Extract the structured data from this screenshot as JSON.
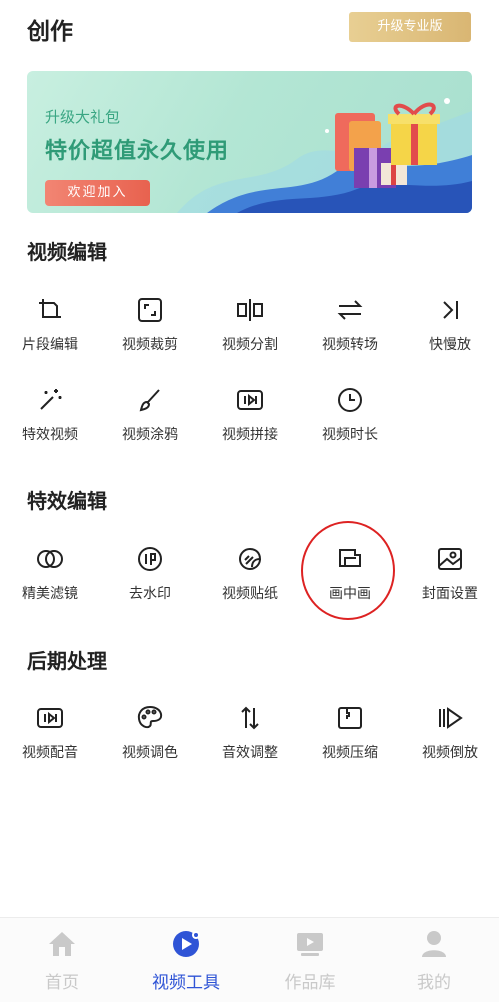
{
  "header": {
    "title": "创作",
    "upgrade_label": "升级专业版"
  },
  "banner": {
    "subtitle": "升级大礼包",
    "headline": "特价超值永久使用",
    "cta": "欢迎加入"
  },
  "sections": [
    {
      "title": "视频编辑",
      "items": [
        {
          "label": "片段编辑",
          "icon": "crop-icon"
        },
        {
          "label": "视频裁剪",
          "icon": "expand-icon"
        },
        {
          "label": "视频分割",
          "icon": "split-icon"
        },
        {
          "label": "视频转场",
          "icon": "transition-icon"
        },
        {
          "label": "快慢放",
          "icon": "speed-icon"
        },
        {
          "label": "特效视频",
          "icon": "magic-wand-icon"
        },
        {
          "label": "视频涂鸦",
          "icon": "brush-icon"
        },
        {
          "label": "视频拼接",
          "icon": "merge-icon"
        },
        {
          "label": "视频时长",
          "icon": "clock-icon"
        }
      ]
    },
    {
      "title": "特效编辑",
      "items": [
        {
          "label": "精美滤镜",
          "icon": "filter-icon"
        },
        {
          "label": "去水印",
          "icon": "stamp-icon"
        },
        {
          "label": "视频贴纸",
          "icon": "sticker-icon"
        },
        {
          "label": "画中画",
          "icon": "picture-in-picture-icon"
        },
        {
          "label": "封面设置",
          "icon": "image-icon"
        }
      ]
    },
    {
      "title": "后期处理",
      "items": [
        {
          "label": "视频配音",
          "icon": "dubbing-icon"
        },
        {
          "label": "视频调色",
          "icon": "palette-icon"
        },
        {
          "label": "音效调整",
          "icon": "sound-adjust-icon"
        },
        {
          "label": "视频压缩",
          "icon": "compress-icon"
        },
        {
          "label": "视频倒放",
          "icon": "reverse-icon"
        }
      ]
    }
  ],
  "tabbar": [
    {
      "label": "首页",
      "icon": "home-icon",
      "active": false
    },
    {
      "label": "视频工具",
      "icon": "video-tools-icon",
      "active": true
    },
    {
      "label": "作品库",
      "icon": "library-icon",
      "active": false
    },
    {
      "label": "我的",
      "icon": "profile-icon",
      "active": false
    }
  ],
  "colors": {
    "accent": "#2f54d6",
    "highlight_circle": "#dd2222",
    "upgrade_gold": "#dfc080",
    "banner_green": "#2f9b77"
  }
}
